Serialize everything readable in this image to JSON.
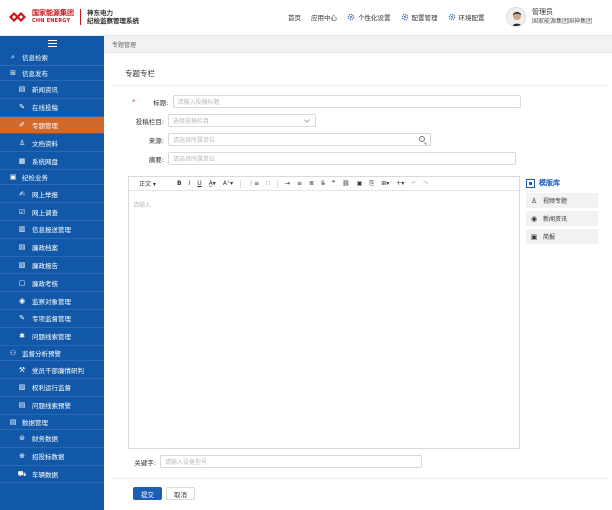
{
  "brand": {
    "logo_cn": "国家能源集团",
    "logo_en": "CHN ENERGY",
    "system_line1": "神东电力",
    "system_line2": "纪检监察管理系统",
    "color": "#c8161d"
  },
  "topnav": {
    "items": [
      "首页",
      "应用中心",
      "个性化设置",
      "配置管理",
      "环境配置"
    ]
  },
  "user": {
    "name": "管理员",
    "org": "国家能源集团国神集团"
  },
  "sidebar": {
    "groups": [
      {
        "label": "信息检索",
        "icon": "search-icon",
        "items": []
      },
      {
        "label": "信息发布",
        "icon": "publish-icon",
        "items": [
          {
            "label": "新闻资讯",
            "icon": "news-icon"
          },
          {
            "label": "在线投稿",
            "icon": "edit-icon"
          },
          {
            "label": "专题管理",
            "icon": "topic-icon",
            "active": true
          },
          {
            "label": "文档资料",
            "icon": "document-icon"
          },
          {
            "label": "系统网盘",
            "icon": "disk-icon"
          }
        ]
      },
      {
        "label": "纪检业务",
        "icon": "business-icon",
        "items": [
          {
            "label": "网上举报",
            "icon": "report-icon"
          },
          {
            "label": "网上调查",
            "icon": "survey-icon"
          },
          {
            "label": "信息报送管理",
            "icon": "submit-icon"
          },
          {
            "label": "廉政档案",
            "icon": "archive-icon"
          },
          {
            "label": "廉政报告",
            "icon": "report-doc-icon"
          },
          {
            "label": "廉政考核",
            "icon": "assess-icon"
          },
          {
            "label": "监察对象管理",
            "icon": "target-icon"
          },
          {
            "label": "专项监督管理",
            "icon": "supervise-icon"
          },
          {
            "label": "问题线索管理",
            "icon": "clue-icon"
          }
        ]
      },
      {
        "label": "监督分析预警",
        "icon": "warning-icon",
        "items": [
          {
            "label": "党员干部廉情研判",
            "icon": "judge-icon"
          },
          {
            "label": "权利运行监督",
            "icon": "power-icon"
          },
          {
            "label": "问题线索预警",
            "icon": "alert-icon"
          }
        ]
      },
      {
        "label": "数据管理",
        "icon": "data-icon",
        "items": [
          {
            "label": "财务数据",
            "icon": "finance-icon"
          },
          {
            "label": "招投标数据",
            "icon": "bid-icon"
          },
          {
            "label": "车辆数据",
            "icon": "car-icon"
          }
        ]
      }
    ]
  },
  "breadcrumb": "专题管理",
  "panel": {
    "title": "专题专栏",
    "fields": {
      "title_label": "标题:",
      "title_placeholder": "请输入投稿标题",
      "column_label": "投稿栏目:",
      "column_placeholder": "选择投稿栏目",
      "source_label": "来源:",
      "source_placeholder": "请选择所属单位",
      "summary_label": "摘要:",
      "summary_placeholder": "请选择所属单位",
      "keyword_label": "关键字:",
      "keyword_placeholder": "请输入设备型号"
    },
    "editor": {
      "format": "正文",
      "placeholder": "请输入"
    },
    "templates": {
      "title": "模版库",
      "items": [
        "视频专题",
        "新闻资讯",
        "简报"
      ]
    },
    "buttons": {
      "submit": "提交",
      "cancel": "取消"
    }
  }
}
